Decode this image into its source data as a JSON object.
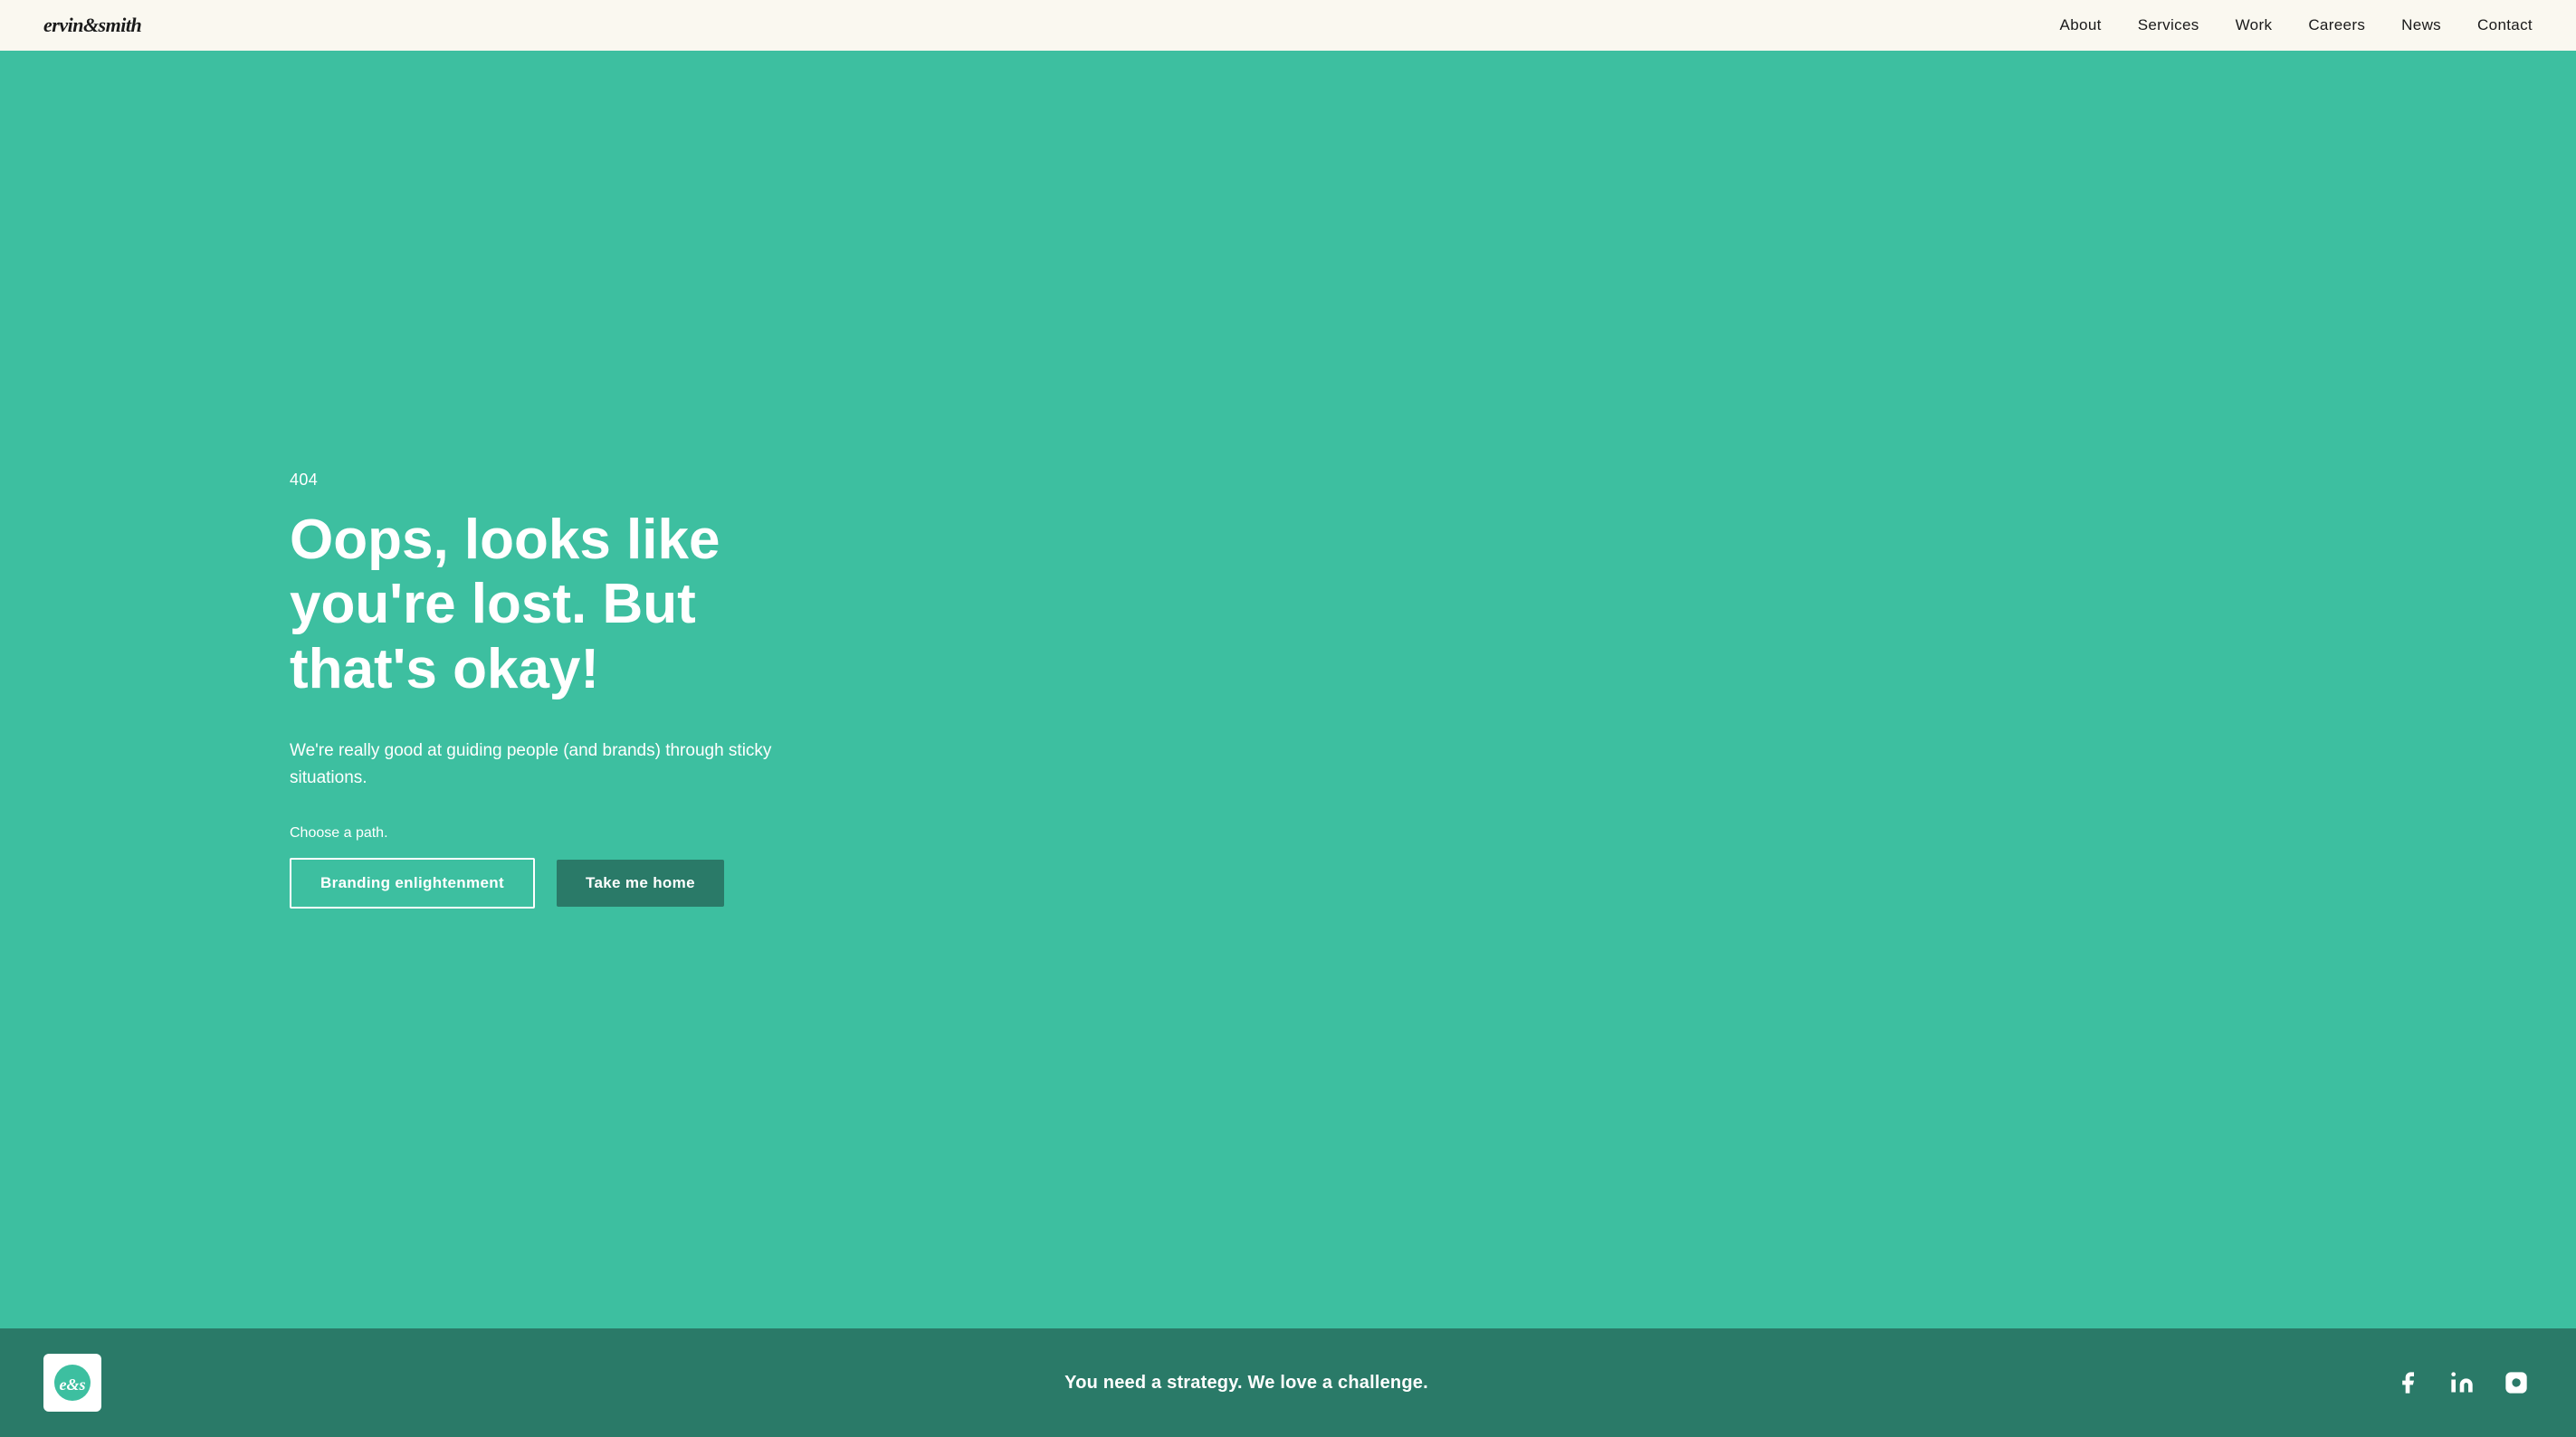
{
  "header": {
    "logo": "ervin&smith",
    "nav": {
      "about": "About",
      "services": "Services",
      "work": "Work",
      "careers": "Careers",
      "news": "News",
      "contact": "Contact"
    }
  },
  "main": {
    "error_code": "404",
    "headline": "Oops, looks like you're lost. But that's okay!",
    "subtext": "We're really good at guiding people (and brands) through sticky situations.",
    "choose_path_label": "Choose a path.",
    "btn_primary_label": "Branding enlightenment",
    "btn_secondary_label": "Take me home"
  },
  "footer": {
    "tagline": "You need a strategy. We love a challenge.",
    "social": {
      "facebook": "Facebook",
      "linkedin": "LinkedIn",
      "instagram": "Instagram"
    }
  },
  "colors": {
    "bg_teal": "#3dbfa0",
    "dark_teal": "#2a7a68",
    "header_bg": "#faf8f0",
    "white": "#ffffff"
  }
}
